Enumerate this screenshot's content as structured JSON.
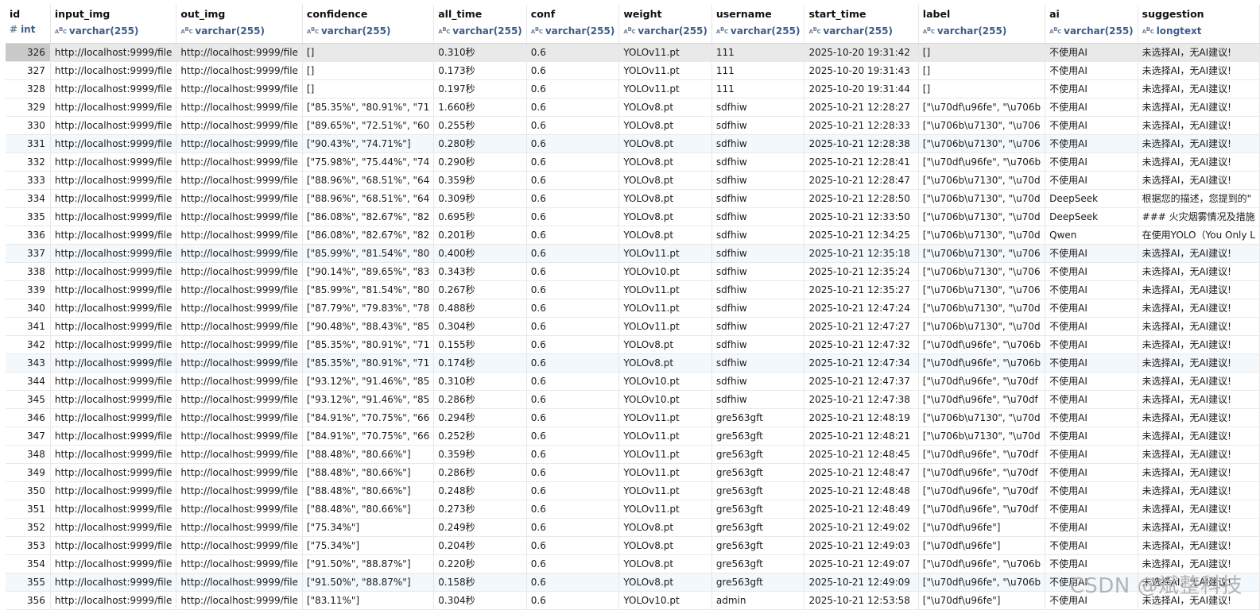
{
  "columns": [
    {
      "name": "id",
      "type": "int",
      "icon": "number-icon"
    },
    {
      "name": "input_img",
      "type": "varchar(255)",
      "icon": "abc-icon"
    },
    {
      "name": "out_img",
      "type": "varchar(255)",
      "icon": "abc-icon"
    },
    {
      "name": "confidence",
      "type": "varchar(255)",
      "icon": "abc-icon"
    },
    {
      "name": "all_time",
      "type": "varchar(255)",
      "icon": "abc-icon"
    },
    {
      "name": "conf",
      "type": "varchar(255)",
      "icon": "abc-icon"
    },
    {
      "name": "weight",
      "type": "varchar(255)",
      "icon": "abc-icon"
    },
    {
      "name": "username",
      "type": "varchar(255)",
      "icon": "abc-icon"
    },
    {
      "name": "start_time",
      "type": "varchar(255)",
      "icon": "abc-icon"
    },
    {
      "name": "label",
      "type": "varchar(255)",
      "icon": "abc-icon"
    },
    {
      "name": "ai",
      "type": "varchar(255)",
      "icon": "abc-icon"
    },
    {
      "name": "suggestion",
      "type": "longtext",
      "icon": "abc-icon"
    }
  ],
  "type_icon_text": {
    "number": "#",
    "abc_a": "A",
    "abc_b": "B",
    "abc_c": "C"
  },
  "rows": [
    [
      "326",
      "http://localhost:9999/file",
      "http://localhost:9999/file",
      "[]",
      "0.310秒",
      "0.6",
      "YOLOv11.pt",
      "111",
      "2025-10-20 19:31:42",
      "[]",
      "不使用AI",
      "未选择AI，无AI建议!"
    ],
    [
      "327",
      "http://localhost:9999/file",
      "http://localhost:9999/file",
      "[]",
      "0.173秒",
      "0.6",
      "YOLOv11.pt",
      "111",
      "2025-10-20 19:31:43",
      "[]",
      "不使用AI",
      "未选择AI，无AI建议!"
    ],
    [
      "328",
      "http://localhost:9999/file",
      "http://localhost:9999/file",
      "[]",
      "0.197秒",
      "0.6",
      "YOLOv11.pt",
      "111",
      "2025-10-20 19:31:44",
      "[]",
      "不使用AI",
      "未选择AI，无AI建议!"
    ],
    [
      "329",
      "http://localhost:9999/file",
      "http://localhost:9999/file",
      "[\"85.35%\", \"80.91%\", \"71",
      "1.660秒",
      "0.6",
      "YOLOv8.pt",
      "sdfhiw",
      "2025-10-21 12:28:27",
      "[\"\\u70df\\u96fe\", \"\\u706b",
      "不使用AI",
      "未选择AI，无AI建议!"
    ],
    [
      "330",
      "http://localhost:9999/file",
      "http://localhost:9999/file",
      "[\"89.65%\", \"72.51%\", \"60",
      "0.255秒",
      "0.6",
      "YOLOv8.pt",
      "sdfhiw",
      "2025-10-21 12:28:33",
      "[\"\\u706b\\u7130\", \"\\u706",
      "不使用AI",
      "未选择AI，无AI建议!"
    ],
    [
      "331",
      "http://localhost:9999/file",
      "http://localhost:9999/file",
      "[\"90.43%\", \"74.71%\"]",
      "0.280秒",
      "0.6",
      "YOLOv8.pt",
      "sdfhiw",
      "2025-10-21 12:28:38",
      "[\"\\u706b\\u7130\", \"\\u706",
      "不使用AI",
      "未选择AI，无AI建议!"
    ],
    [
      "332",
      "http://localhost:9999/file",
      "http://localhost:9999/file",
      "[\"75.98%\", \"75.44%\", \"74",
      "0.290秒",
      "0.6",
      "YOLOv8.pt",
      "sdfhiw",
      "2025-10-21 12:28:41",
      "[\"\\u70df\\u96fe\", \"\\u706b",
      "不使用AI",
      "未选择AI，无AI建议!"
    ],
    [
      "333",
      "http://localhost:9999/file",
      "http://localhost:9999/file",
      "[\"88.96%\", \"68.51%\", \"64",
      "0.359秒",
      "0.6",
      "YOLOv8.pt",
      "sdfhiw",
      "2025-10-21 12:28:47",
      "[\"\\u706b\\u7130\", \"\\u70d",
      "不使用AI",
      "未选择AI，无AI建议!"
    ],
    [
      "334",
      "http://localhost:9999/file",
      "http://localhost:9999/file",
      "[\"88.96%\", \"68.51%\", \"64",
      "0.309秒",
      "0.6",
      "YOLOv8.pt",
      "sdfhiw",
      "2025-10-21 12:28:50",
      "[\"\\u706b\\u7130\", \"\\u70d",
      "DeepSeek",
      "根据您的描述，您提到的\""
    ],
    [
      "335",
      "http://localhost:9999/file",
      "http://localhost:9999/file",
      "[\"86.08%\", \"82.67%\", \"82",
      "0.695秒",
      "0.6",
      "YOLOv8.pt",
      "sdfhiw",
      "2025-10-21 12:33:50",
      "[\"\\u706b\\u7130\", \"\\u70d",
      "DeepSeek",
      "### 火灾烟雾情况及措施"
    ],
    [
      "336",
      "http://localhost:9999/file",
      "http://localhost:9999/file",
      "[\"86.08%\", \"82.67%\", \"82",
      "0.201秒",
      "0.6",
      "YOLOv8.pt",
      "sdfhiw",
      "2025-10-21 12:34:25",
      "[\"\\u706b\\u7130\", \"\\u70d",
      "Qwen",
      "在使用YOLO（You Only L"
    ],
    [
      "337",
      "http://localhost:9999/file",
      "http://localhost:9999/file",
      "[\"85.99%\", \"81.54%\", \"80",
      "0.400秒",
      "0.6",
      "YOLOv11.pt",
      "sdfhiw",
      "2025-10-21 12:35:18",
      "[\"\\u706b\\u7130\", \"\\u706",
      "不使用AI",
      "未选择AI，无AI建议!"
    ],
    [
      "338",
      "http://localhost:9999/file",
      "http://localhost:9999/file",
      "[\"90.14%\", \"89.65%\", \"83",
      "0.343秒",
      "0.6",
      "YOLOv10.pt",
      "sdfhiw",
      "2025-10-21 12:35:24",
      "[\"\\u706b\\u7130\", \"\\u706",
      "不使用AI",
      "未选择AI，无AI建议!"
    ],
    [
      "339",
      "http://localhost:9999/file",
      "http://localhost:9999/file",
      "[\"85.99%\", \"81.54%\", \"80",
      "0.267秒",
      "0.6",
      "YOLOv11.pt",
      "sdfhiw",
      "2025-10-21 12:35:27",
      "[\"\\u706b\\u7130\", \"\\u706",
      "不使用AI",
      "未选择AI，无AI建议!"
    ],
    [
      "340",
      "http://localhost:9999/file",
      "http://localhost:9999/file",
      "[\"87.79%\", \"79.83%\", \"78",
      "0.488秒",
      "0.6",
      "YOLOv11.pt",
      "sdfhiw",
      "2025-10-21 12:47:24",
      "[\"\\u706b\\u7130\", \"\\u70d",
      "不使用AI",
      "未选择AI，无AI建议!"
    ],
    [
      "341",
      "http://localhost:9999/file",
      "http://localhost:9999/file",
      "[\"90.48%\", \"88.43%\", \"85",
      "0.304秒",
      "0.6",
      "YOLOv11.pt",
      "sdfhiw",
      "2025-10-21 12:47:27",
      "[\"\\u706b\\u7130\", \"\\u70d",
      "不使用AI",
      "未选择AI，无AI建议!"
    ],
    [
      "342",
      "http://localhost:9999/file",
      "http://localhost:9999/file",
      "[\"85.35%\", \"80.91%\", \"71",
      "0.155秒",
      "0.6",
      "YOLOv8.pt",
      "sdfhiw",
      "2025-10-21 12:47:32",
      "[\"\\u70df\\u96fe\", \"\\u706b",
      "不使用AI",
      "未选择AI，无AI建议!"
    ],
    [
      "343",
      "http://localhost:9999/file",
      "http://localhost:9999/file",
      "[\"85.35%\", \"80.91%\", \"71",
      "0.174秒",
      "0.6",
      "YOLOv8.pt",
      "sdfhiw",
      "2025-10-21 12:47:34",
      "[\"\\u70df\\u96fe\", \"\\u706b",
      "不使用AI",
      "未选择AI，无AI建议!"
    ],
    [
      "344",
      "http://localhost:9999/file",
      "http://localhost:9999/file",
      "[\"93.12%\", \"91.46%\", \"85",
      "0.310秒",
      "0.6",
      "YOLOv10.pt",
      "sdfhiw",
      "2025-10-21 12:47:37",
      "[\"\\u70df\\u96fe\", \"\\u70df",
      "不使用AI",
      "未选择AI，无AI建议!"
    ],
    [
      "345",
      "http://localhost:9999/file",
      "http://localhost:9999/file",
      "[\"93.12%\", \"91.46%\", \"85",
      "0.286秒",
      "0.6",
      "YOLOv10.pt",
      "sdfhiw",
      "2025-10-21 12:47:38",
      "[\"\\u70df\\u96fe\", \"\\u70df",
      "不使用AI",
      "未选择AI，无AI建议!"
    ],
    [
      "346",
      "http://localhost:9999/file",
      "http://localhost:9999/file",
      "[\"84.91%\", \"70.75%\", \"66",
      "0.294秒",
      "0.6",
      "YOLOv11.pt",
      "gre563gft",
      "2025-10-21 12:48:19",
      "[\"\\u706b\\u7130\", \"\\u70d",
      "不使用AI",
      "未选择AI，无AI建议!"
    ],
    [
      "347",
      "http://localhost:9999/file",
      "http://localhost:9999/file",
      "[\"84.91%\", \"70.75%\", \"66",
      "0.252秒",
      "0.6",
      "YOLOv11.pt",
      "gre563gft",
      "2025-10-21 12:48:21",
      "[\"\\u706b\\u7130\", \"\\u70d",
      "不使用AI",
      "未选择AI，无AI建议!"
    ],
    [
      "348",
      "http://localhost:9999/file",
      "http://localhost:9999/file",
      "[\"88.48%\", \"80.66%\"]",
      "0.359秒",
      "0.6",
      "YOLOv11.pt",
      "gre563gft",
      "2025-10-21 12:48:45",
      "[\"\\u70df\\u96fe\", \"\\u70df",
      "不使用AI",
      "未选择AI，无AI建议!"
    ],
    [
      "349",
      "http://localhost:9999/file",
      "http://localhost:9999/file",
      "[\"88.48%\", \"80.66%\"]",
      "0.286秒",
      "0.6",
      "YOLOv11.pt",
      "gre563gft",
      "2025-10-21 12:48:47",
      "[\"\\u70df\\u96fe\", \"\\u70df",
      "不使用AI",
      "未选择AI，无AI建议!"
    ],
    [
      "350",
      "http://localhost:9999/file",
      "http://localhost:9999/file",
      "[\"88.48%\", \"80.66%\"]",
      "0.248秒",
      "0.6",
      "YOLOv11.pt",
      "gre563gft",
      "2025-10-21 12:48:48",
      "[\"\\u70df\\u96fe\", \"\\u70df",
      "不使用AI",
      "未选择AI，无AI建议!"
    ],
    [
      "351",
      "http://localhost:9999/file",
      "http://localhost:9999/file",
      "[\"88.48%\", \"80.66%\"]",
      "0.273秒",
      "0.6",
      "YOLOv11.pt",
      "gre563gft",
      "2025-10-21 12:48:49",
      "[\"\\u70df\\u96fe\", \"\\u70df",
      "不使用AI",
      "未选择AI，无AI建议!"
    ],
    [
      "352",
      "http://localhost:9999/file",
      "http://localhost:9999/file",
      "[\"75.34%\"]",
      "0.249秒",
      "0.6",
      "YOLOv8.pt",
      "gre563gft",
      "2025-10-21 12:49:02",
      "[\"\\u70df\\u96fe\"]",
      "不使用AI",
      "未选择AI，无AI建议!"
    ],
    [
      "353",
      "http://localhost:9999/file",
      "http://localhost:9999/file",
      "[\"75.34%\"]",
      "0.204秒",
      "0.6",
      "YOLOv8.pt",
      "gre563gft",
      "2025-10-21 12:49:03",
      "[\"\\u70df\\u96fe\"]",
      "不使用AI",
      "未选择AI，无AI建议!"
    ],
    [
      "354",
      "http://localhost:9999/file",
      "http://localhost:9999/file",
      "[\"91.50%\", \"88.87%\"]",
      "0.220秒",
      "0.6",
      "YOLOv8.pt",
      "gre563gft",
      "2025-10-21 12:49:07",
      "[\"\\u70df\\u96fe\", \"\\u706b",
      "不使用AI",
      "未选择AI，无AI建议!"
    ],
    [
      "355",
      "http://localhost:9999/file",
      "http://localhost:9999/file",
      "[\"91.50%\", \"88.87%\"]",
      "0.158秒",
      "0.6",
      "YOLOv8.pt",
      "gre563gft",
      "2025-10-21 12:49:09",
      "[\"\\u70df\\u96fe\", \"\\u706b",
      "不使用AI",
      "未选择AI，无AI建议!"
    ],
    [
      "356",
      "http://localhost:9999/file",
      "http://localhost:9999/file",
      "[\"83.11%\"]",
      "0.304秒",
      "0.6",
      "YOLOv10.pt",
      "admin",
      "2025-10-21 12:53:58",
      "[\"\\u70df\\u96fe\"]",
      "不使用AI",
      "未选择AI，无AI建议!"
    ]
  ],
  "selected_row_index": 0,
  "highlighted_row_indices": [
    5,
    11,
    17,
    29
  ],
  "watermark": "CSDN @斌整科技",
  "colors": {
    "selected_row": "#e9e9e9",
    "selected_id_cell": "#c9c9c9",
    "alt_row": "#f3f8fd",
    "type_text": "#3d5c8a"
  }
}
